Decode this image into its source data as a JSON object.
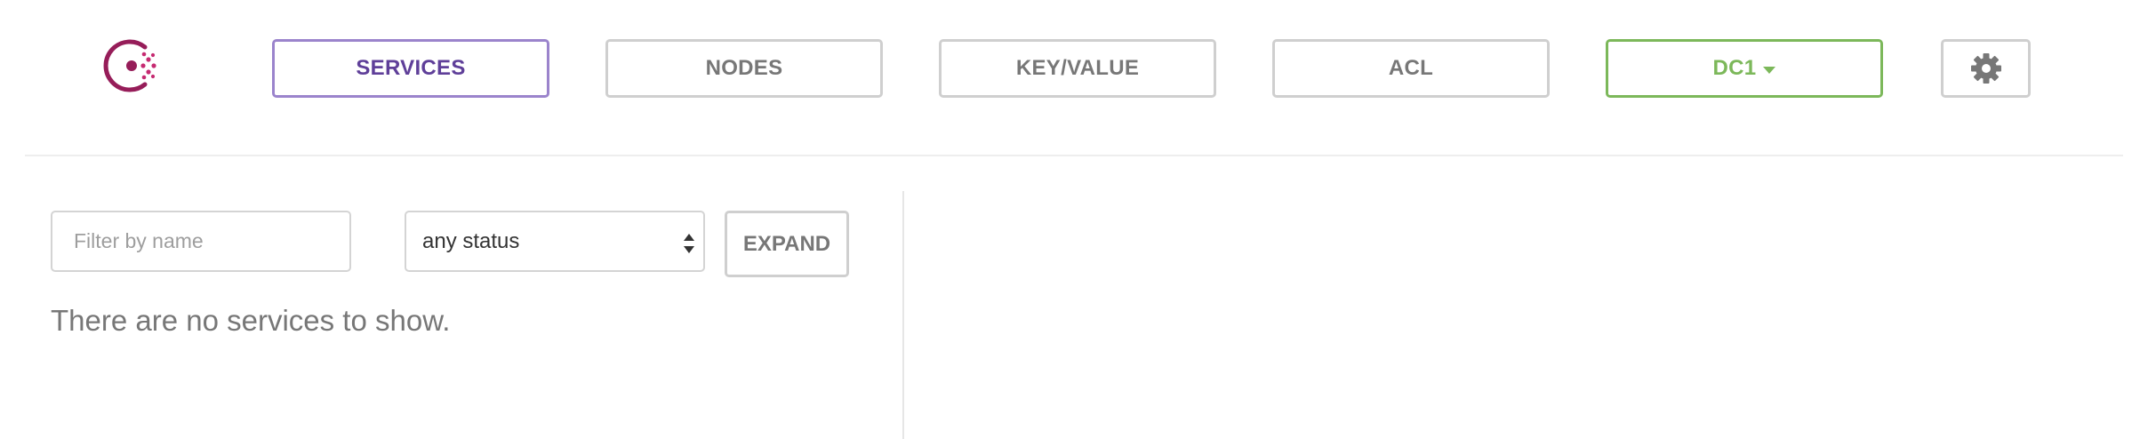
{
  "header": {
    "logo_icon": "consul-logo-icon",
    "nav": [
      {
        "label": "SERVICES",
        "active": true
      },
      {
        "label": "NODES",
        "active": false
      },
      {
        "label": "KEY/VALUE",
        "active": false
      },
      {
        "label": "ACL",
        "active": false
      }
    ],
    "datacenter": {
      "label": "DC1",
      "icon": "caret-down-icon"
    },
    "settings_icon": "gear-icon"
  },
  "sidebar": {
    "filter": {
      "placeholder": "Filter by name",
      "value": ""
    },
    "status_select": {
      "value": "any status",
      "icon": "select-arrows-icon"
    },
    "expand_label": "EXPAND",
    "empty_message": "There are no services to show."
  },
  "colors": {
    "active_border": "#9b84cc",
    "active_text": "#5f3f99",
    "dc_green": "#7cb85a",
    "logo_red": "#c62a71",
    "logo_purple": "#961d59",
    "button_border": "#cfcfcf",
    "button_text": "#777777"
  }
}
